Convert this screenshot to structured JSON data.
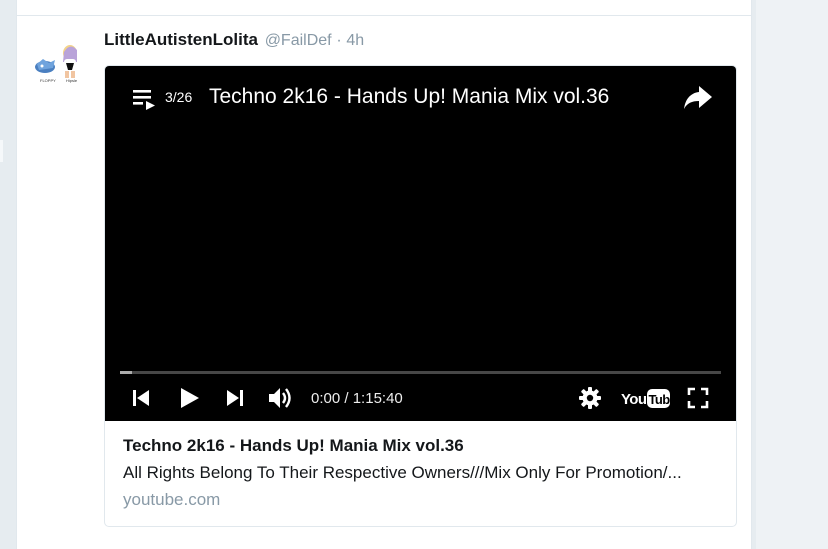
{
  "tweet": {
    "fullname": "LittleAutistenLolita",
    "username": "@FailDef",
    "separator": "·",
    "time": "4h",
    "avatar_captions": [
      "FLOPPY",
      "Hipsle"
    ]
  },
  "player": {
    "playlist_index": "3/26",
    "title": "Techno 2k16 - Hands Up! Mania Mix vol.36",
    "current_time": "0:00",
    "time_separator": "/",
    "duration": "1:15:40",
    "progress_fraction": 0,
    "youtube_logo_text": "YouTube"
  },
  "card": {
    "title": "Techno 2k16 - Hands Up! Mania Mix vol.36",
    "description": "All Rights Belong To Their Respective Owners///Mix Only For Promotion/...",
    "domain": "youtube.com"
  },
  "icons": {
    "playlist": "playlist-icon",
    "share": "share-icon",
    "previous": "skip-previous-icon",
    "play": "play-icon",
    "next": "skip-next-icon",
    "volume": "volume-icon",
    "settings": "gear-icon",
    "fullscreen": "fullscreen-icon"
  },
  "colors": {
    "link_gray": "#8899a6",
    "text_dark": "#14171a",
    "player_bg": "#000000",
    "border": "#e1e8ed"
  }
}
